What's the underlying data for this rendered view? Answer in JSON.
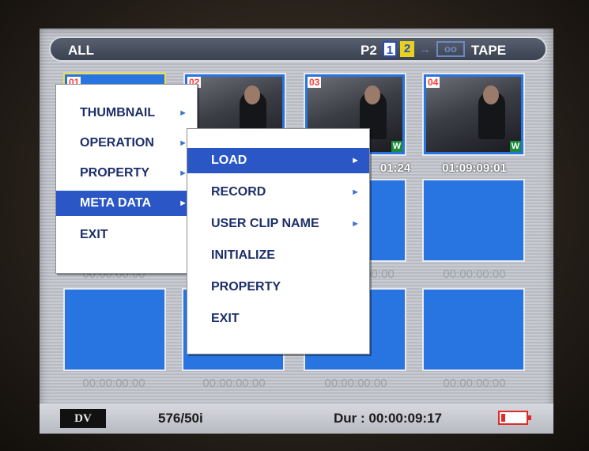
{
  "header": {
    "mode": "ALL",
    "p2_label": "P2",
    "slot1": "1",
    "slot2": "2",
    "arrow": "→",
    "tape_box": "oo",
    "tape_label": "TAPE"
  },
  "thumbnails": [
    {
      "num": "01",
      "timecode": "",
      "has_w": false
    },
    {
      "num": "02",
      "timecode": "",
      "has_w": false
    },
    {
      "num": "03",
      "timecode": "01:24",
      "has_w": true
    },
    {
      "num": "04",
      "timecode": "01:09:09:01",
      "has_w": true
    }
  ],
  "empty_timecodes": {
    "row2": [
      "00:00:00:00",
      "00:00",
      "00:00:00:00"
    ],
    "row3": [
      "00:00:00:00",
      "00:00:00:00",
      "00:00:00:00",
      "00:00:00:00"
    ]
  },
  "badge_w": "W",
  "menu_main": {
    "items": [
      {
        "label": "THUMBNAIL",
        "arrow": "►",
        "selected": false
      },
      {
        "label": "OPERATION",
        "arrow": "►",
        "selected": false
      },
      {
        "label": "PROPERTY",
        "arrow": "►",
        "selected": false
      },
      {
        "label": "META DATA",
        "arrow": "►",
        "selected": true
      },
      {
        "label": "EXIT",
        "arrow": "",
        "selected": false
      }
    ]
  },
  "menu_sub": {
    "items": [
      {
        "label": "LOAD",
        "arrow": "►",
        "selected": true
      },
      {
        "label": "RECORD",
        "arrow": "►",
        "selected": false
      },
      {
        "label": "USER CLIP NAME",
        "arrow": "►",
        "selected": false
      },
      {
        "label": "INITIALIZE",
        "arrow": "",
        "selected": false
      },
      {
        "label": "PROPERTY",
        "arrow": "",
        "selected": false
      },
      {
        "label": "EXIT",
        "arrow": "",
        "selected": false
      }
    ]
  },
  "footer": {
    "format_badge": "DV",
    "format": "576/50i",
    "duration": "Dur : 00:00:09:17"
  },
  "colors": {
    "highlight": "#2a56c6",
    "thumb_blue": "#2874e0",
    "menu_text": "#1c2f68"
  }
}
